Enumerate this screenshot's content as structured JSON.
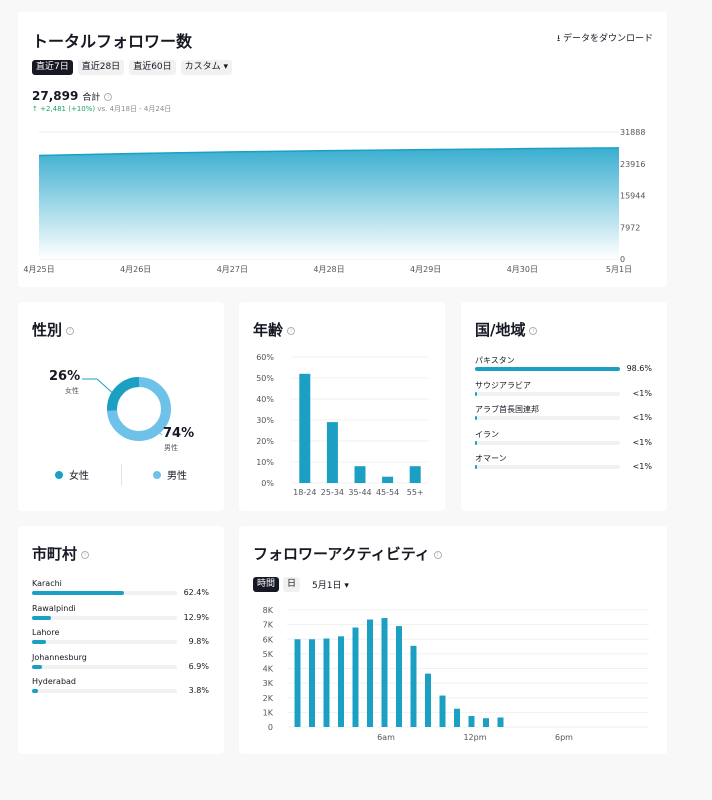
{
  "total": {
    "title": "トータルフォロワー数",
    "download_label": "データをダウンロード",
    "download_icon": "download-icon",
    "range_tabs": [
      "直近7日",
      "直近28日",
      "直近60日",
      "カスタム ▾"
    ],
    "active_range": 0,
    "total_value": "27,899",
    "total_label": "合計",
    "delta": "+2,481 (+10%)",
    "delta_text": "vs. 4月18日 - 4月24日",
    "accent": "#1ba0c4"
  },
  "gender": {
    "title": "性別",
    "female_pct": "26%",
    "female_label": "女性",
    "male_pct": "74%",
    "male_label": "男性",
    "female_value": 26,
    "male_value": 74,
    "female_color": "#1ba0c4",
    "male_color": "#6ec1e8"
  },
  "age": {
    "title": "年齢"
  },
  "country": {
    "title": "国/地域",
    "items": [
      {
        "name": "パキスタン",
        "value": "98.6%",
        "fraction": 0.986
      },
      {
        "name": "サウジアラビア",
        "value": "<1%",
        "fraction": 0.01
      },
      {
        "name": "アラブ首長国連邦",
        "value": "<1%",
        "fraction": 0.008
      },
      {
        "name": "イラン",
        "value": "<1%",
        "fraction": 0.005
      },
      {
        "name": "オマーン",
        "value": "<1%",
        "fraction": 0.004
      }
    ]
  },
  "city": {
    "title": "市町村",
    "items": [
      {
        "name": "Karachi",
        "value": "62.4%",
        "fraction": 0.624
      },
      {
        "name": "Rawalpindi",
        "value": "12.9%",
        "fraction": 0.129
      },
      {
        "name": "Lahore",
        "value": "9.8%",
        "fraction": 0.098
      },
      {
        "name": "Johannesburg",
        "value": "6.9%",
        "fraction": 0.069
      },
      {
        "name": "Hyderabad",
        "value": "3.8%",
        "fraction": 0.038
      }
    ]
  },
  "activity": {
    "title": "フォロワーアクティビティ",
    "tabs": [
      "時間",
      "日"
    ],
    "active_tab": 0,
    "date": "5月1日 ▾"
  },
  "chart_data": [
    {
      "type": "area",
      "x": [
        "4月25日",
        "4月26日",
        "4月27日",
        "4月28日",
        "4月29日",
        "4月30日",
        "5月1日"
      ],
      "values": [
        26000,
        26500,
        26900,
        27200,
        27450,
        27700,
        27899
      ],
      "ylim": [
        0,
        31888
      ],
      "yticks": [
        "31888",
        "23916",
        "15944",
        "7972",
        "0"
      ],
      "grid": true
    },
    {
      "type": "bar",
      "categories": [
        "18-24",
        "25-34",
        "35-44",
        "45-54",
        "55+"
      ],
      "values": [
        52,
        29,
        8,
        3,
        8
      ],
      "ylim": [
        0,
        60
      ],
      "yticks": [
        "60%",
        "50%",
        "40%",
        "30%",
        "20%",
        "10%",
        "0%"
      ],
      "grid": true
    },
    {
      "type": "bar",
      "x": [
        1,
        2,
        3,
        4,
        5,
        6,
        7,
        8,
        9,
        10,
        11,
        12,
        13,
        14,
        15,
        16
      ],
      "values": [
        6000,
        6000,
        6050,
        6200,
        6800,
        7350,
        7450,
        6900,
        5550,
        3650,
        2150,
        1250,
        750,
        600,
        650,
        0
      ],
      "xticks": [
        "6am",
        "12pm",
        "6pm"
      ],
      "ylim": [
        0,
        8000
      ],
      "yticks": [
        "8K",
        "7K",
        "6K",
        "5K",
        "4K",
        "3K",
        "2K",
        "1K",
        "0"
      ],
      "grid": true
    }
  ]
}
